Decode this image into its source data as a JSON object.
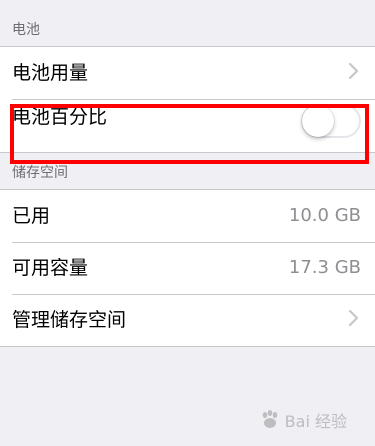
{
  "battery_section": {
    "header": "电池",
    "rows": [
      {
        "label": "电池用量",
        "accessory": "chevron-right-icon"
      },
      {
        "label": "电池百分比",
        "accessory": "toggle",
        "toggle_on": false
      }
    ]
  },
  "storage_section": {
    "header": "储存空间",
    "rows": [
      {
        "label": "已用",
        "value": "10.0 GB"
      },
      {
        "label": "可用容量",
        "value": "17.3 GB"
      },
      {
        "label": "管理储存空间",
        "accessory": "chevron-right-icon"
      }
    ]
  },
  "highlight": {
    "color": "#ff0000"
  },
  "watermark": {
    "text": "Bai 经验"
  },
  "colors": {
    "background": "#efeff4",
    "header_text": "#6d6d72",
    "separator": "#c8c7cc",
    "value_text": "#8e8e93",
    "chevron": "#c7c7cc"
  }
}
